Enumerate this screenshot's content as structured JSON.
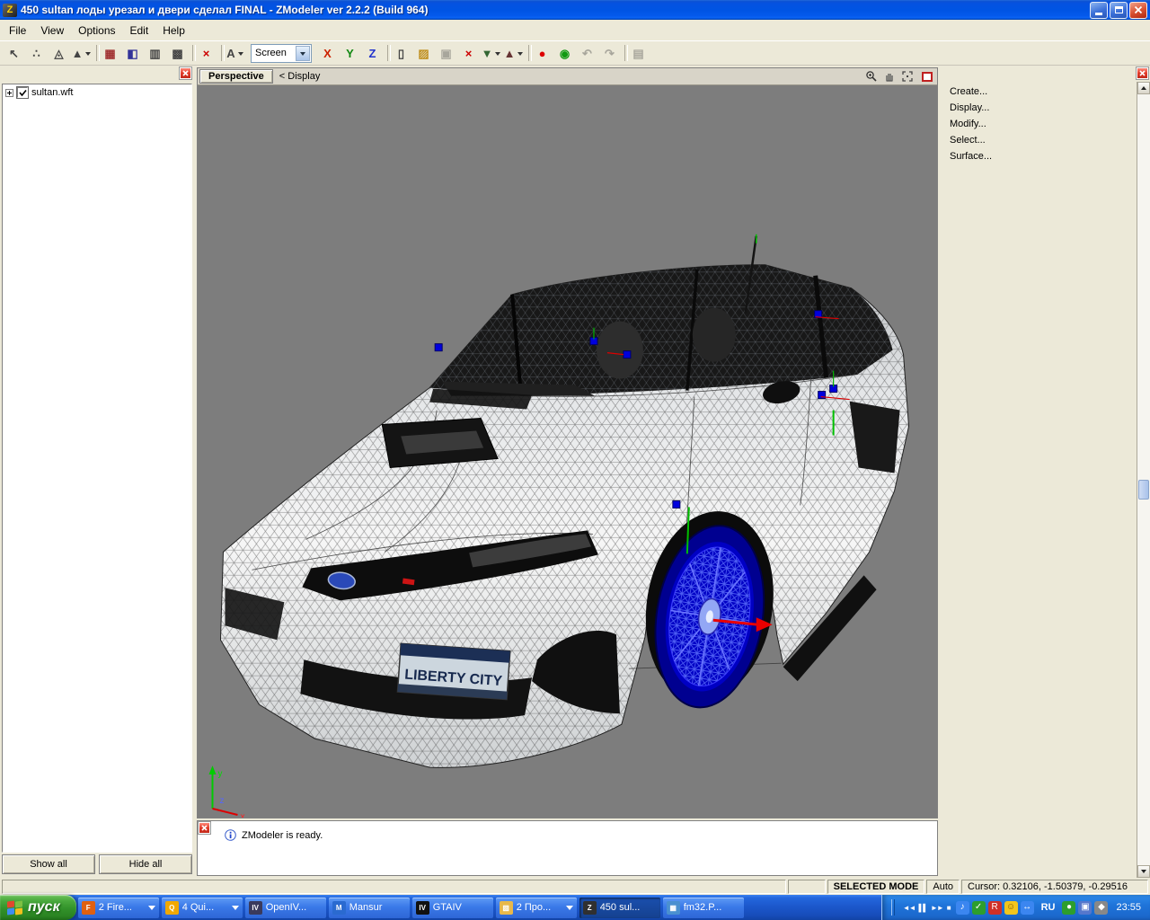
{
  "window": {
    "title": "450 sultan лоды урезал и двери сделал FINAL - ZModeler ver 2.2.2 (Build 964)",
    "icon_glyph": "Z"
  },
  "menu": {
    "items": [
      {
        "name": "menu-file",
        "label": "File"
      },
      {
        "name": "menu-view",
        "label": "View"
      },
      {
        "name": "menu-options",
        "label": "Options"
      },
      {
        "name": "menu-edit",
        "label": "Edit"
      },
      {
        "name": "menu-help",
        "label": "Help"
      }
    ]
  },
  "toolbar": {
    "group1": [
      {
        "name": "select-mode-button",
        "glyph": "↖"
      },
      {
        "name": "vertices-mode-button",
        "glyph": "∴"
      },
      {
        "name": "edges-mode-button",
        "glyph": "◬"
      },
      {
        "name": "faces-mode-button",
        "glyph": "▲",
        "dropdown": true
      },
      {
        "sep": true
      },
      {
        "name": "uv-mapper-button",
        "glyph": "▦",
        "color": "#a03030"
      },
      {
        "name": "material-editor-button",
        "glyph": "◧",
        "color": "#333399"
      },
      {
        "name": "views-config-button",
        "glyph": "▥"
      },
      {
        "name": "wire-views-button",
        "glyph": "▩"
      },
      {
        "sep": true
      },
      {
        "name": "close-view-button",
        "glyph": "×",
        "color": "#cc0000"
      },
      {
        "sep": true
      },
      {
        "name": "arrow-tool-button",
        "glyph": "A",
        "dropdown": true
      }
    ],
    "screen_combo_value": "Screen",
    "group2": [
      {
        "name": "axis-x-toggle",
        "glyph": "X",
        "color": "#cc2200"
      },
      {
        "name": "axis-y-toggle",
        "glyph": "Y",
        "color": "#118811"
      },
      {
        "name": "axis-z-toggle",
        "glyph": "Z",
        "color": "#2233cc"
      },
      {
        "sep": true
      },
      {
        "name": "new-file-button",
        "glyph": "▯"
      },
      {
        "name": "open-file-button",
        "glyph": "▨",
        "color": "#c09020"
      },
      {
        "name": "save-file-button",
        "glyph": "▣",
        "grayed": true
      },
      {
        "name": "delete-button",
        "glyph": "×",
        "color": "#cc0000"
      },
      {
        "name": "import-button",
        "glyph": "▼",
        "color": "#336633",
        "dropdown": true
      },
      {
        "name": "export-button",
        "glyph": "▲",
        "color": "#663333",
        "dropdown": true
      },
      {
        "sep": true
      },
      {
        "name": "record-button",
        "glyph": "●",
        "color": "#dd0000"
      },
      {
        "name": "plugins-button",
        "glyph": "◉",
        "color": "#119911"
      },
      {
        "name": "undo-button",
        "glyph": "↶",
        "grayed": true
      },
      {
        "name": "redo-button",
        "glyph": "↷",
        "grayed": true
      },
      {
        "sep": true
      },
      {
        "name": "settings-button",
        "glyph": "▤",
        "grayed": true
      }
    ]
  },
  "left_panel": {
    "tree_root": "sultan.wft",
    "show_all_label": "Show all",
    "hide_all_label": "Hide all"
  },
  "viewport": {
    "mode_button": "Perspective",
    "display_label": "< Display",
    "plate_text": "LIBERTY CITY",
    "axis_labels": {
      "x": "x",
      "y": "y",
      "z": "z"
    }
  },
  "right_panel": {
    "items": [
      {
        "name": "menu-create",
        "label": "Create..."
      },
      {
        "name": "menu-display",
        "label": "Display..."
      },
      {
        "name": "menu-modify",
        "label": "Modify..."
      },
      {
        "name": "menu-select",
        "label": "Select..."
      },
      {
        "name": "menu-surface",
        "label": "Surface..."
      }
    ]
  },
  "message_bar": {
    "text": "ZModeler is ready."
  },
  "status_bar": {
    "selected_mode": "SELECTED MODE",
    "auto_label": "Auto",
    "cursor": "Cursor: 0.32106, -1.50379, -0.29516"
  },
  "taskbar": {
    "start_label": "пуск",
    "items": [
      {
        "name": "task-firefox",
        "label": "2 Fire...",
        "glyph": "F",
        "iconbg": "#e06010",
        "dropdown": true
      },
      {
        "name": "task-qip",
        "label": "4 Qui...",
        "glyph": "Q",
        "iconbg": "#f0a800",
        "dropdown": true
      },
      {
        "name": "task-openiv",
        "label": "OpenIV...",
        "glyph": "IV",
        "iconbg": "#3a3a5c"
      },
      {
        "name": "task-mansur",
        "label": "Mansur",
        "glyph": "M",
        "iconbg": "#2a6ad0"
      },
      {
        "name": "task-gtaiv",
        "label": "GTAIV",
        "glyph": "IV",
        "iconbg": "#111111"
      },
      {
        "name": "task-folder",
        "label": "2 Про...",
        "glyph": "▨",
        "iconbg": "#e8b84a",
        "dropdown": true
      },
      {
        "name": "task-zmodeler",
        "label": "450 sul...",
        "glyph": "Z",
        "iconbg": "#303030",
        "active": true
      },
      {
        "name": "task-image",
        "label": "fm32.P...",
        "glyph": "▦",
        "iconbg": "#4a90d0"
      }
    ],
    "media_controls": [
      {
        "name": "media-prev-button",
        "glyph": "◄◄"
      },
      {
        "name": "media-pause-button",
        "glyph": "▌▌"
      },
      {
        "name": "media-next-button",
        "glyph": "►►"
      },
      {
        "name": "media-stop-button",
        "glyph": "■"
      }
    ],
    "tray_icons_left": [
      {
        "name": "tray-volume-icon",
        "glyph": "♪",
        "bg": "#3b86f0"
      },
      {
        "name": "tray-antivirus-icon",
        "glyph": "✓",
        "bg": "#2d9e2d"
      },
      {
        "name": "tray-r-icon",
        "glyph": "R",
        "bg": "#d03028"
      },
      {
        "name": "tray-smiley-icon",
        "glyph": "☺",
        "bg": "#f2c51d",
        "color": "#7a5800"
      },
      {
        "name": "tray-network-icon",
        "glyph": "↔",
        "bg": "#3b86f0"
      }
    ],
    "lang_indicator": "RU",
    "tray_icons_right": [
      {
        "name": "tray-update-icon",
        "glyph": "●",
        "bg": "#2d9e2d"
      },
      {
        "name": "tray-display-icon",
        "glyph": "▣",
        "bg": "#5577cc"
      },
      {
        "name": "tray-usb-icon",
        "glyph": "◆",
        "bg": "#888888"
      }
    ],
    "clock": "23:55"
  },
  "colors": {
    "viewport_bg": "#7d7d7d",
    "selected_wheel": "#0000c4",
    "axis_x": "#dd0000",
    "axis_y": "#00cc00",
    "axis_z": "#5566ff"
  }
}
